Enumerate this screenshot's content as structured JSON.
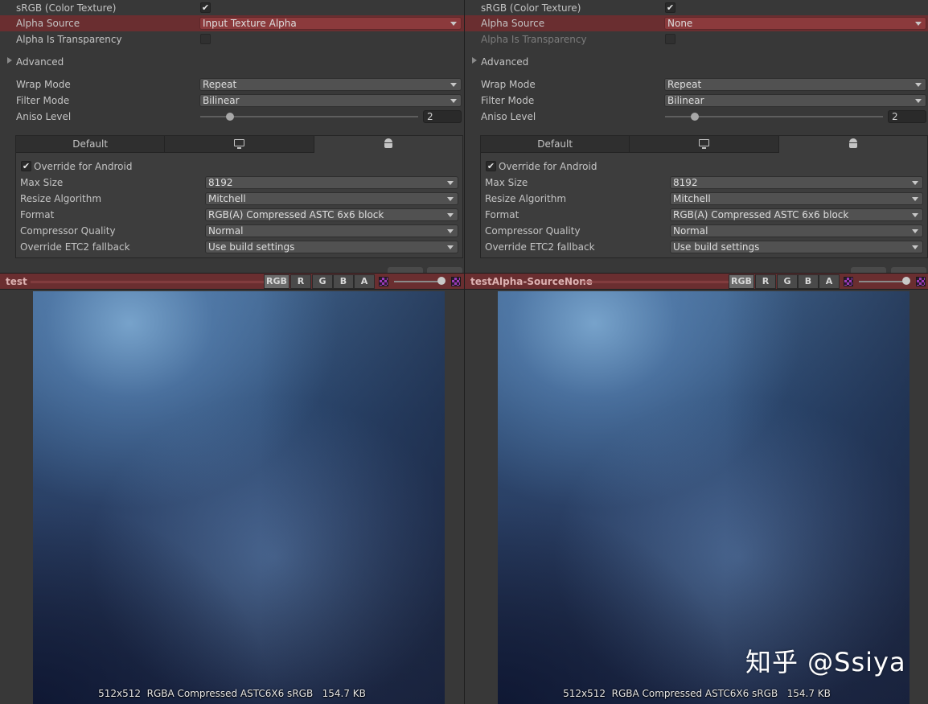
{
  "panels": [
    {
      "srgb_label": "sRGB (Color Texture)",
      "srgb_checked": "✔",
      "alpha_source_label": "Alpha Source",
      "alpha_source_value": "Input Texture Alpha",
      "alpha_is_transparency_label": "Alpha Is Transparency",
      "advanced_label": "Advanced",
      "wrap_mode_label": "Wrap Mode",
      "wrap_mode_value": "Repeat",
      "filter_mode_label": "Filter Mode",
      "filter_mode_value": "Bilinear",
      "aniso_level_label": "Aniso Level",
      "aniso_level_value": "2",
      "tab_default": "Default",
      "override_android_check": "✔",
      "override_android_label": "Override for Android",
      "max_size_label": "Max Size",
      "max_size_value": "8192",
      "resize_algorithm_label": "Resize Algorithm",
      "resize_algorithm_value": "Mitchell",
      "format_label": "Format",
      "format_value": "RGB(A) Compressed ASTC 6x6 block",
      "compressor_quality_label": "Compressor Quality",
      "compressor_quality_value": "Normal",
      "override_etc2_label": "Override ETC2 fallback",
      "override_etc2_value": "Use build settings",
      "preview_title": "test",
      "ch_rgb": "RGB",
      "ch_r": "R",
      "ch_g": "G",
      "ch_b": "B",
      "ch_a": "A",
      "texture_info": "512x512  RGBA Compressed ASTC6X6 sRGB   154.7 KB"
    },
    {
      "srgb_label": "sRGB (Color Texture)",
      "srgb_checked": "✔",
      "alpha_source_label": "Alpha Source",
      "alpha_source_value": "None",
      "alpha_is_transparency_label": "Alpha Is Transparency",
      "advanced_label": "Advanced",
      "wrap_mode_label": "Wrap Mode",
      "wrap_mode_value": "Repeat",
      "filter_mode_label": "Filter Mode",
      "filter_mode_value": "Bilinear",
      "aniso_level_label": "Aniso Level",
      "aniso_level_value": "2",
      "tab_default": "Default",
      "override_android_check": "✔",
      "override_android_label": "Override for Android",
      "max_size_label": "Max Size",
      "max_size_value": "8192",
      "resize_algorithm_label": "Resize Algorithm",
      "resize_algorithm_value": "Mitchell",
      "format_label": "Format",
      "format_value": "RGB(A) Compressed ASTC 6x6 block",
      "compressor_quality_label": "Compressor Quality",
      "compressor_quality_value": "Normal",
      "override_etc2_label": "Override ETC2 fallback",
      "override_etc2_value": "Use build settings",
      "preview_title": "testAlpha-SourceNone",
      "ch_rgb": "RGB",
      "ch_r": "R",
      "ch_g": "G",
      "ch_b": "B",
      "ch_a": "A",
      "texture_info": "512x512  RGBA Compressed ASTC6X6 sRGB   154.7 KB"
    }
  ],
  "icons": {
    "standalone_tab": "monitor-icon",
    "android_tab": "android-icon",
    "mip_toggle": "checker-icon",
    "alpha_toggle": "checker-icon"
  },
  "colors": {
    "panel_bg": "#383838",
    "highlight_row": "#6a2e30",
    "alpha_dropdown": "#8b3a3c",
    "preview_bar": "#6a2e30"
  },
  "watermark": "知乎 @Ssiya"
}
